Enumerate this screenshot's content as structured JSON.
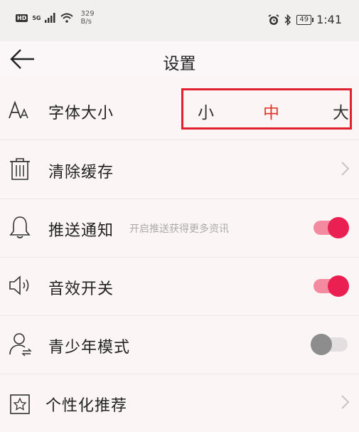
{
  "status_bar": {
    "hd": "HD",
    "network": "5G",
    "speed_value": "329",
    "speed_unit": "B/s",
    "battery": "49",
    "time": "1:41"
  },
  "header": {
    "title": "设置"
  },
  "settings": {
    "font_size": {
      "label": "字体大小",
      "options": [
        "小",
        "中",
        "大"
      ],
      "selected": "中",
      "selected_color": "#e3362a"
    },
    "clear_cache": {
      "label": "清除缓存"
    },
    "push_notifications": {
      "label": "推送通知",
      "hint": "开启推送获得更多资讯",
      "enabled": true
    },
    "sound_effects": {
      "label": "音效开关",
      "enabled": true
    },
    "teen_mode": {
      "label": "青少年模式",
      "enabled": false
    },
    "personalized_recommend": {
      "label": "个性化推荐"
    }
  },
  "colors": {
    "toggle_on": "#ea1f52",
    "toggle_off": "#8d8d8d",
    "highlight_border": "#e0202e"
  }
}
